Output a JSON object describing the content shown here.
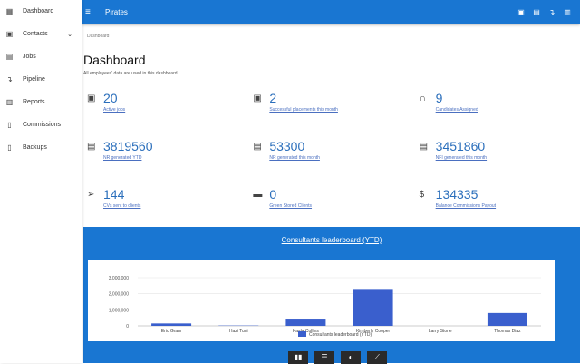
{
  "app": {
    "title": "Pirates",
    "menu_icon": "hamburger-icon",
    "top_icons": [
      "contact-card-icon",
      "jobs-icon",
      "pipeline-icon",
      "reports-icon"
    ]
  },
  "sidebar": {
    "items": [
      {
        "label": "Dashboard",
        "icon": "dashboard-icon",
        "glyph": "▦"
      },
      {
        "label": "Contacts",
        "icon": "contacts-icon",
        "glyph": "▣",
        "chevron": "⌄"
      },
      {
        "label": "Jobs",
        "icon": "jobs-icon",
        "glyph": "▤"
      },
      {
        "label": "Pipeline",
        "icon": "pipeline-icon",
        "glyph": "↴"
      },
      {
        "label": "Reports",
        "icon": "reports-icon",
        "glyph": "▥"
      },
      {
        "label": "Commissions",
        "icon": "commissions-icon",
        "glyph": "▯"
      },
      {
        "label": "Backups",
        "icon": "backups-icon",
        "glyph": "▯"
      }
    ]
  },
  "breadcrumb": "Dashboard",
  "page": {
    "title": "Dashboard",
    "subtitle": "All employees' data are used in this dashboard"
  },
  "stats": [
    {
      "value": "20",
      "label": "Active jobs",
      "glyph": "▣"
    },
    {
      "value": "2",
      "label": "Successful placements this month",
      "glyph": "▣"
    },
    {
      "value": "9",
      "label": "Candidates Assigned",
      "glyph": "∩"
    },
    {
      "value": "3819560",
      "label": "NR generated YTD",
      "glyph": "▤"
    },
    {
      "value": "53300",
      "label": "NR generated this month",
      "glyph": "▤"
    },
    {
      "value": "3451860",
      "label": "NFI generated this month",
      "glyph": "▤"
    },
    {
      "value": "144",
      "label": "CVs sent to clients",
      "glyph": "➢"
    },
    {
      "value": "0",
      "label": "Green Stored Clients",
      "glyph": "▬"
    },
    {
      "value": "134335",
      "label": "Balance Commissions Payout",
      "glyph": "$"
    }
  ],
  "chart_data": {
    "type": "bar",
    "title": "Consultants leaderboard (YTD)",
    "categories": [
      "Eric Gram",
      "Hazi Tuni",
      "Kayla Collins",
      "Kimberly Cooper",
      "Larry Stone",
      "Thomas Diaz"
    ],
    "values": [
      150000,
      20000,
      450000,
      2300000,
      0,
      800000
    ],
    "ylim": [
      0,
      3000000
    ],
    "yticks": [
      "0",
      "1,000,000",
      "2,000,000",
      "3,000,000"
    ],
    "legend": "Consultants leaderboard (YTD)",
    "color": "#3a5fcd"
  },
  "chart_buttons": [
    "bar-chart-icon",
    "table-icon",
    "pie-chart-icon",
    "line-chart-icon"
  ]
}
